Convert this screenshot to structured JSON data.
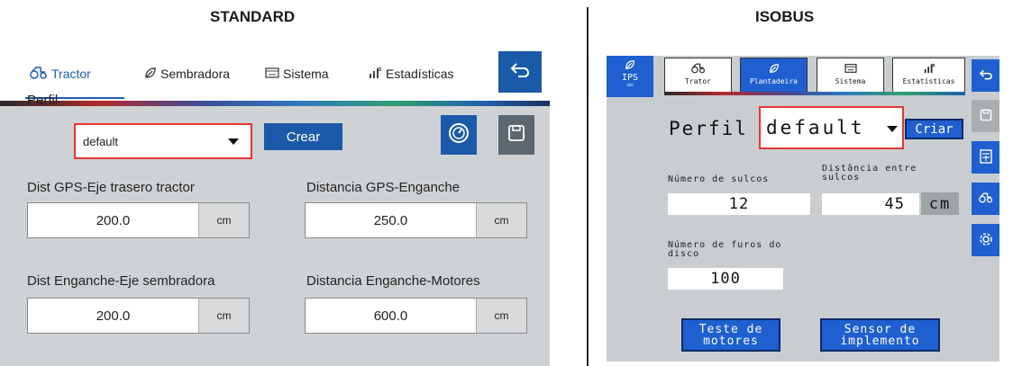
{
  "headings": {
    "standard": "STANDARD",
    "isobus": "ISOBUS"
  },
  "standard": {
    "tabs": [
      {
        "label": "Tractor",
        "icon": "tractor-icon",
        "active": true
      },
      {
        "label": "Sembradora",
        "icon": "seed-icon",
        "active": false
      },
      {
        "label": "Sistema",
        "icon": "display-icon",
        "active": false
      },
      {
        "label": "Estadísticas",
        "icon": "stats-icon",
        "active": false
      }
    ],
    "profile": {
      "label": "Perfil",
      "selected": "default",
      "create_label": "Crear"
    },
    "fields": [
      {
        "label": "Dist GPS-Eje trasero tractor",
        "value": "200.0",
        "unit": "cm"
      },
      {
        "label": "Distancia GPS-Enganche",
        "value": "250.0",
        "unit": "cm"
      },
      {
        "label": "Dist Enganche-Eje sembradora",
        "value": "200.0",
        "unit": "cm"
      },
      {
        "label": "Distancia Enganche-Motores",
        "value": "600.0",
        "unit": "cm"
      }
    ]
  },
  "isobus": {
    "ips": {
      "label": "IPS",
      "sub": "000"
    },
    "tabs": [
      {
        "label": "Trator",
        "icon": "tractor-icon",
        "active": false
      },
      {
        "label": "Plantadeira",
        "icon": "seed-icon",
        "active": true
      },
      {
        "label": "Sistema",
        "icon": "display-icon",
        "active": false
      },
      {
        "label": "Estatísticas",
        "icon": "stats-icon",
        "active": false
      }
    ],
    "profile": {
      "label": "Perfil",
      "selected": "default",
      "create_label": "Criar"
    },
    "fields": {
      "sulcos": {
        "label": "Número de sulcos",
        "value": "12"
      },
      "distancia": {
        "label_line1": "Distância entre",
        "label_line2": "sulcos",
        "value": "45",
        "unit": "cm"
      },
      "furos": {
        "label_line1": "Número de furos do",
        "label_line2": "disco",
        "value": "100"
      }
    },
    "buttons": {
      "teste": {
        "line1": "Teste de",
        "line2": "motores"
      },
      "sensor": {
        "line1": "Sensor de",
        "line2": "implemento"
      }
    }
  },
  "colors": {
    "accent_blue": "#1b5aa8",
    "isobus_blue": "#1f5fcf",
    "highlight_red": "#e53535",
    "panel_gray": "#cfd2d4"
  }
}
